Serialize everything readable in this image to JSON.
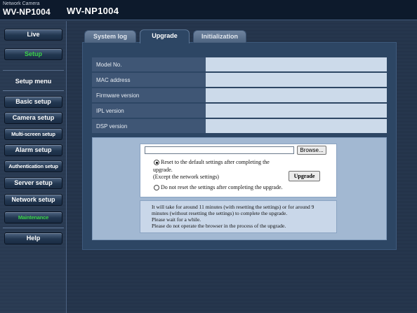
{
  "header": {
    "brand_small": "Network Camera",
    "brand_model": "WV-NP1004",
    "title": "WV-NP1004"
  },
  "sidebar": {
    "live_label": "Live",
    "setup_label": "Setup",
    "setup_menu_label": "Setup menu",
    "items": [
      {
        "label": "Basic setup"
      },
      {
        "label": "Camera setup"
      },
      {
        "label": "Multi-screen setup"
      },
      {
        "label": "Alarm setup"
      },
      {
        "label": "Authentication setup"
      },
      {
        "label": "Server setup"
      },
      {
        "label": "Network setup"
      },
      {
        "label": "Maintenance"
      }
    ],
    "help_label": "Help"
  },
  "tabs": [
    {
      "label": "System log"
    },
    {
      "label": "Upgrade"
    },
    {
      "label": "Initialization"
    }
  ],
  "info_table": {
    "rows": [
      {
        "label": "Model No.",
        "value": ""
      },
      {
        "label": "MAC address",
        "value": ""
      },
      {
        "label": "Firmware version",
        "value": ""
      },
      {
        "label": "IPL version",
        "value": ""
      },
      {
        "label": "DSP version",
        "value": ""
      }
    ]
  },
  "upgrade": {
    "file_value": "",
    "browse_label": "Browse...",
    "option1_line1": "Reset to the default settings after completing the",
    "option1_line2": "upgrade.",
    "option1_line3": "(Except the network settings)",
    "option2_label": "Do not reset the settings after completing the upgrade.",
    "upgrade_button": "Upgrade",
    "note_lines": [
      "It will take for around 11 minutes (with resetting the settings) or for around 9",
      "minutes (without resetting the settings) to complete the upgrade.",
      "Please wait for a while.",
      "Please do not operate the browser in the process of the upgrade."
    ]
  }
}
